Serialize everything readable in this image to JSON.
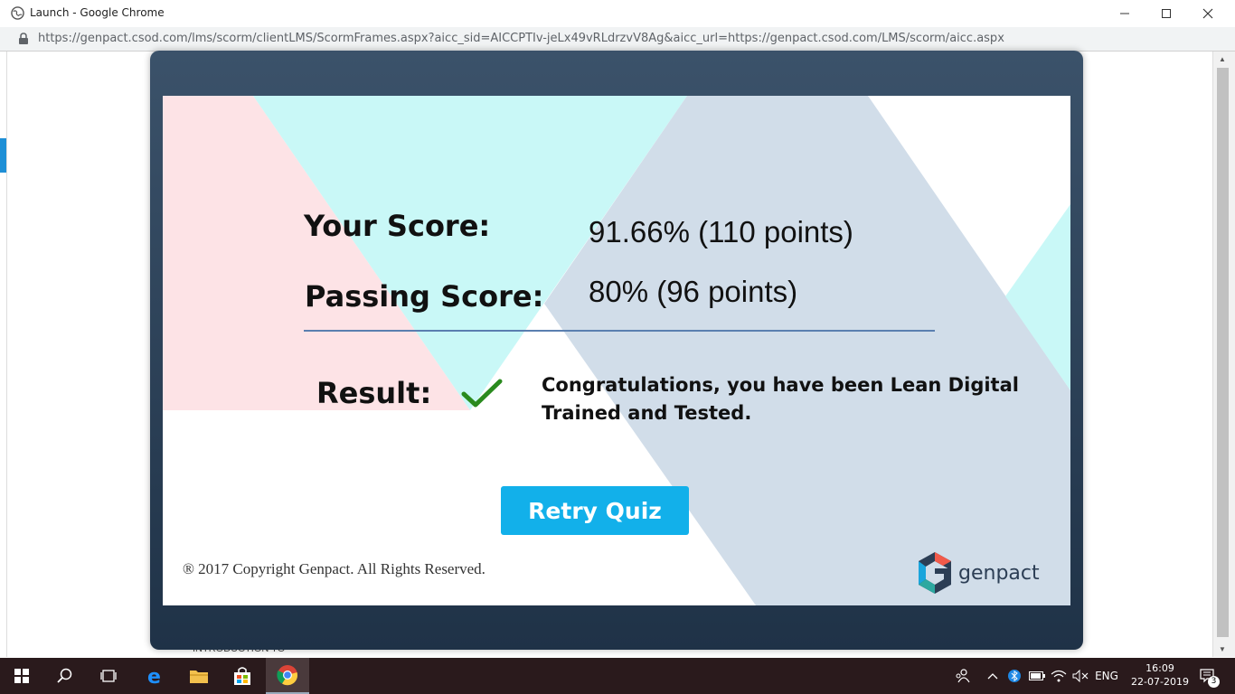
{
  "window": {
    "title": "Launch - Google Chrome",
    "url": "https://genpact.csod.com/lms/scorm/clientLMS/ScormFrames.aspx?aicc_sid=AICCPTIv-jeLx49vRLdrzvV8Ag&aicc_url=https://genpact.csod.com/LMS/scorm/aicc.aspx"
  },
  "background_page": {
    "partial_text": "INTRODUCTION TO"
  },
  "result": {
    "your_score_label": "Your Score:",
    "your_score_value": "91.66% (110 points)",
    "passing_score_label": "Passing Score:",
    "passing_score_value": "80% (96 points)",
    "result_label": "Result:",
    "result_icon": "checkmark-icon",
    "message": "Congratulations, you have been Lean Digital Trained and Tested.",
    "retry_button": "Retry Quiz",
    "copyright": "® 2017 Copyright Genpact. All Rights Reserved.",
    "brand": "genpact"
  },
  "taskbar": {
    "language": "ENG",
    "time": "16:09",
    "date": "22-07-2019",
    "notification_count": "3"
  },
  "colors": {
    "accent_button": "#12b0ea",
    "modal_frame": "#2c3e55",
    "check": "#2a8a1e"
  }
}
